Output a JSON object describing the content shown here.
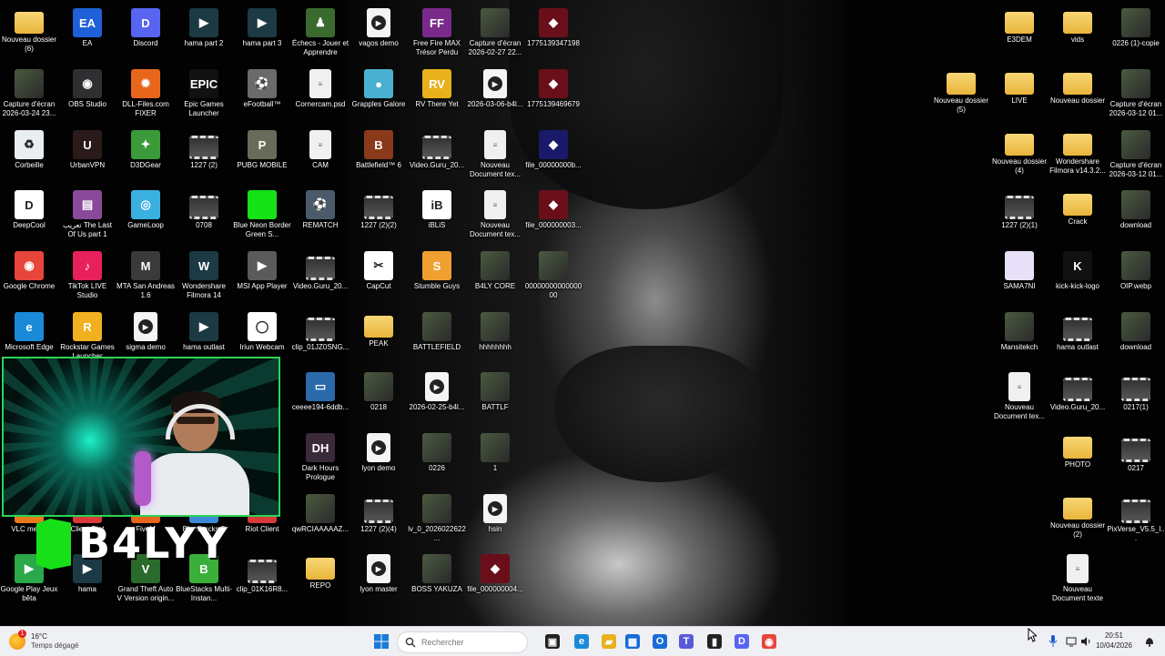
{
  "desktop": {
    "icons": [
      {
        "label": "Nouveau dossier (6)",
        "kind": "folder",
        "glyph": ""
      },
      {
        "label": "EA",
        "kind": "app",
        "glyph": "EA",
        "color": "#1f5fd8"
      },
      {
        "label": "Discord",
        "kind": "app",
        "glyph": "D",
        "color": "#5865f2"
      },
      {
        "label": "hama part 2",
        "kind": "app",
        "glyph": "▶",
        "color": "#1b3a44"
      },
      {
        "label": "hama part 3",
        "kind": "app",
        "glyph": "▶",
        "color": "#1b3a44"
      },
      {
        "label": "Échecs - Jouer et Apprendre",
        "kind": "app",
        "glyph": "♟",
        "color": "#3b6a2e"
      },
      {
        "label": "vagos demo",
        "kind": "video",
        "glyph": "▶"
      },
      {
        "label": "Free Fire MAX Trésor Perdu",
        "kind": "app",
        "glyph": "FF",
        "color": "#7a2a8a"
      },
      {
        "label": "Capture d'écran 2026-02-27 22...",
        "kind": "thumb",
        "glyph": ""
      },
      {
        "label": "1775139347198",
        "kind": "app",
        "glyph": "◆",
        "color": "#6a0f1a"
      },
      {
        "label": "Capture d'écran 2026-03-24 23...",
        "kind": "thumb",
        "glyph": ""
      },
      {
        "label": "OBS Studio",
        "kind": "app",
        "glyph": "◉",
        "color": "#302e31"
      },
      {
        "label": "DLL-Files.com FIXER",
        "kind": "app",
        "glyph": "✹",
        "color": "#e8661c"
      },
      {
        "label": "Epic Games Launcher",
        "kind": "app",
        "glyph": "EPIC",
        "color": "#111"
      },
      {
        "label": "eFootball™",
        "kind": "app",
        "glyph": "⚽",
        "color": "#6a6a6a"
      },
      {
        "label": "Cornercam.psd",
        "kind": "file",
        "glyph": ""
      },
      {
        "label": "Grapples Galore",
        "kind": "app",
        "glyph": "●",
        "color": "#4ab0d0"
      },
      {
        "label": "RV There Yet",
        "kind": "app",
        "glyph": "RV",
        "color": "#e8b11c"
      },
      {
        "label": "2026-03-06-b4l...",
        "kind": "video",
        "glyph": "▶"
      },
      {
        "label": "1775139469679",
        "kind": "app",
        "glyph": "◆",
        "color": "#6a0f1a"
      },
      {
        "label": "Corbeille",
        "kind": "app",
        "glyph": "♻",
        "color": "#e9eef2"
      },
      {
        "label": "UrbanVPN",
        "kind": "app",
        "glyph": "U",
        "color": "#2a1a1a"
      },
      {
        "label": "D3DGear",
        "kind": "app",
        "glyph": "✦",
        "color": "#3a9a3a"
      },
      {
        "label": "1227 (2)",
        "kind": "film",
        "glyph": ""
      },
      {
        "label": "PUBG MOBILE",
        "kind": "app",
        "glyph": "P",
        "color": "#6a6a5a"
      },
      {
        "label": "CAM",
        "kind": "file",
        "glyph": ""
      },
      {
        "label": "Battlefield™ 6",
        "kind": "app",
        "glyph": "B",
        "color": "#8a3a1a"
      },
      {
        "label": "Video.Guru_20...",
        "kind": "film",
        "glyph": ""
      },
      {
        "label": "Nouveau Document tex...",
        "kind": "file",
        "glyph": ""
      },
      {
        "label": "file_00000000b...",
        "kind": "app",
        "glyph": "◆",
        "color": "#1a1a6a"
      },
      {
        "label": "DeepCool",
        "kind": "app",
        "glyph": "D",
        "color": "#fff"
      },
      {
        "label": "تعريب The Last Of Us part 1",
        "kind": "app",
        "glyph": "▤",
        "color": "#8a4a9a"
      },
      {
        "label": "GameLoop",
        "kind": "app",
        "glyph": "◎",
        "color": "#3ab0e0"
      },
      {
        "label": "0708",
        "kind": "film",
        "glyph": ""
      },
      {
        "label": "Blue Neon Border Green S...",
        "kind": "app",
        "glyph": "",
        "color": "#16e016"
      },
      {
        "label": "REMATCH",
        "kind": "app",
        "glyph": "⚽",
        "color": "#4a5a6a"
      },
      {
        "label": "1227 (2)(2)",
        "kind": "film",
        "glyph": ""
      },
      {
        "label": "iBLiS",
        "kind": "app",
        "glyph": "iB",
        "color": "#fff"
      },
      {
        "label": "Nouveau Document tex...",
        "kind": "file",
        "glyph": ""
      },
      {
        "label": "file_000000003...",
        "kind": "app",
        "glyph": "◆",
        "color": "#6a0f1a"
      },
      {
        "label": "Google Chrome",
        "kind": "app",
        "glyph": "◉",
        "color": "#e8453c"
      },
      {
        "label": "TikTok LIVE Studio",
        "kind": "app",
        "glyph": "♪",
        "color": "#e8205c"
      },
      {
        "label": "MTA San Andreas 1.6",
        "kind": "app",
        "glyph": "M",
        "color": "#3a3a3a"
      },
      {
        "label": "Wondershare Filmora 14",
        "kind": "app",
        "glyph": "W",
        "color": "#1b3a44"
      },
      {
        "label": "MSI App Player",
        "kind": "app",
        "glyph": "▶",
        "color": "#5a5a5a"
      },
      {
        "label": "Video.Guru_20...",
        "kind": "film",
        "glyph": ""
      },
      {
        "label": "CapCut",
        "kind": "app",
        "glyph": "✂",
        "color": "#fff"
      },
      {
        "label": "Stumble Guys",
        "kind": "app",
        "glyph": "S",
        "color": "#f0a030"
      },
      {
        "label": "B4LY CORE",
        "kind": "thumb",
        "glyph": ""
      },
      {
        "label": "0000000000000000",
        "kind": "thumb",
        "glyph": ""
      },
      {
        "label": "Microsoft Edge",
        "kind": "app",
        "glyph": "e",
        "color": "#1a8ad8"
      },
      {
        "label": "Rockstar Games Launcher",
        "kind": "app",
        "glyph": "R",
        "color": "#f0b020"
      },
      {
        "label": "sigma demo",
        "kind": "video",
        "glyph": "▶"
      },
      {
        "label": "hama outlast",
        "kind": "app",
        "glyph": "▶",
        "color": "#1b3a44"
      },
      {
        "label": "Iriun Webcam",
        "kind": "app",
        "glyph": "◯",
        "color": "#fff"
      },
      {
        "label": "clip_01JZ0SNG...",
        "kind": "film",
        "glyph": ""
      },
      {
        "label": "PEAK",
        "kind": "folder",
        "glyph": ""
      },
      {
        "label": "BATTLEFIELD",
        "kind": "thumb",
        "glyph": ""
      },
      {
        "label": "hhhhhhhh",
        "kind": "thumb",
        "glyph": ""
      },
      {
        "label": "ceeee194-6ddb...",
        "kind": "app",
        "glyph": "▭",
        "color": "#2a6aaa"
      },
      {
        "label": "0218",
        "kind": "thumb",
        "glyph": ""
      },
      {
        "label": "2026-02-25-b4l...",
        "kind": "video",
        "glyph": "▶"
      },
      {
        "label": "BATTLF",
        "kind": "thumb",
        "glyph": ""
      },
      {
        "label": "Dark Hours Prologue",
        "kind": "app",
        "glyph": "DH",
        "color": "#3a2a3a"
      },
      {
        "label": "lyon demo",
        "kind": "video",
        "glyph": "▶"
      },
      {
        "label": "0226",
        "kind": "thumb",
        "glyph": ""
      },
      {
        "label": "1",
        "kind": "thumb",
        "glyph": ""
      },
      {
        "label": "VLC media",
        "kind": "app",
        "glyph": "▲",
        "color": "#e87a1c"
      },
      {
        "label": "Client Riot",
        "kind": "app",
        "glyph": "R",
        "color": "#d83a3a"
      },
      {
        "label": "FiveM",
        "kind": "app",
        "glyph": "F",
        "color": "#e8661c"
      },
      {
        "label": "BlueStacks 5",
        "kind": "app",
        "glyph": "B",
        "color": "#3a8ad8"
      },
      {
        "label": "Riot Client",
        "kind": "app",
        "glyph": "R",
        "color": "#d83a3a"
      },
      {
        "label": "qwRCIAAAAAZ...",
        "kind": "thumb",
        "glyph": ""
      },
      {
        "label": "1227 (2)(4)",
        "kind": "film",
        "glyph": ""
      },
      {
        "label": "lv_0_2026022622...",
        "kind": "thumb",
        "glyph": ""
      },
      {
        "label": "hsin",
        "kind": "video",
        "glyph": "▶"
      },
      {
        "label": "Google Play Jeux bêta",
        "kind": "app",
        "glyph": "▶",
        "color": "#2aa84a"
      },
      {
        "label": "hama",
        "kind": "app",
        "glyph": "▶",
        "color": "#1b3a44"
      },
      {
        "label": "Grand Theft Auto V Version origin...",
        "kind": "app",
        "glyph": "V",
        "color": "#2a6a2a"
      },
      {
        "label": "BlueStacks Multi-Instan...",
        "kind": "app",
        "glyph": "B",
        "color": "#3ab03a"
      },
      {
        "label": "clip_01K16R8...",
        "kind": "film",
        "glyph": ""
      },
      {
        "label": "REPO",
        "kind": "folder",
        "glyph": ""
      },
      {
        "label": "lyon master",
        "kind": "video",
        "glyph": "▶"
      },
      {
        "label": "BOSS YAKUZA",
        "kind": "thumb",
        "glyph": ""
      },
      {
        "label": "file_000000004...",
        "kind": "app",
        "glyph": "◆",
        "color": "#6a0f1a"
      },
      {
        "label": "Nouveau dossier (3)",
        "kind": "folder",
        "glyph": ""
      },
      {
        "label": "E3DEM",
        "kind": "folder",
        "glyph": ""
      },
      {
        "label": "vids",
        "kind": "folder",
        "glyph": ""
      },
      {
        "label": "0226 (1)-copie",
        "kind": "thumb",
        "glyph": ""
      },
      {
        "label": "Nouveau dossier (5)",
        "kind": "folder",
        "glyph": ""
      },
      {
        "label": "LIVE",
        "kind": "folder",
        "glyph": ""
      },
      {
        "label": "Nouveau dossier",
        "kind": "folder",
        "glyph": ""
      },
      {
        "label": "Capture d'écran 2026-03-12 01...",
        "kind": "thumb",
        "glyph": ""
      },
      {
        "label": "Nouveau dossier (4)",
        "kind": "folder",
        "glyph": ""
      },
      {
        "label": "Wondershare Filmora v14.3.2...",
        "kind": "folder",
        "glyph": ""
      },
      {
        "label": "Capture d'écran 2026-03-12 01...",
        "kind": "thumb",
        "glyph": ""
      },
      {
        "label": "1227 (2)(1)",
        "kind": "film",
        "glyph": ""
      },
      {
        "label": "Crack",
        "kind": "folder",
        "glyph": ""
      },
      {
        "label": "download",
        "kind": "thumb",
        "glyph": ""
      },
      {
        "label": "SAMA7NI",
        "kind": "app",
        "glyph": "",
        "color": "#e8e0f8"
      },
      {
        "label": "kick-kick-logo",
        "kind": "app",
        "glyph": "K",
        "color": "#111"
      },
      {
        "label": "OIP.webp",
        "kind": "thumb",
        "glyph": ""
      },
      {
        "label": "Mansitekch",
        "kind": "thumb",
        "glyph": ""
      },
      {
        "label": "hama outlast",
        "kind": "film",
        "glyph": ""
      },
      {
        "label": "download",
        "kind": "thumb",
        "glyph": ""
      },
      {
        "label": "Nouveau Document tex...",
        "kind": "file",
        "glyph": ""
      },
      {
        "label": "Video.Guru_20...",
        "kind": "film",
        "glyph": ""
      },
      {
        "label": "0217(1)",
        "kind": "film",
        "glyph": ""
      },
      {
        "label": "PHOTO",
        "kind": "folder",
        "glyph": ""
      },
      {
        "label": "0217",
        "kind": "film",
        "glyph": ""
      },
      {
        "label": "Nouveau dossier (2)",
        "kind": "folder",
        "glyph": ""
      },
      {
        "label": "PixVerse_V5.5_l...",
        "kind": "film",
        "glyph": ""
      },
      {
        "label": "Nouveau Document texte",
        "kind": "file",
        "glyph": ""
      }
    ]
  },
  "overlay": {
    "logo_text": "B4LYY"
  },
  "taskbar": {
    "weather": {
      "temp": "16°C",
      "condition": "Temps dégagé",
      "alert_count": "1"
    },
    "search_placeholder": "Rechercher",
    "apps": [
      {
        "name": "windows-start",
        "glyph": "⊞",
        "color": "#1a7ad8"
      },
      {
        "name": "task-view",
        "glyph": "▣",
        "color": "#222"
      },
      {
        "name": "edge",
        "glyph": "e",
        "color": "#1a8ad8"
      },
      {
        "name": "file-explorer",
        "glyph": "▰",
        "color": "#e8b11c"
      },
      {
        "name": "microsoft-store",
        "glyph": "▦",
        "color": "#1a6ad8"
      },
      {
        "name": "outlook",
        "glyph": "O",
        "color": "#1a6ad8"
      },
      {
        "name": "teams",
        "glyph": "T",
        "color": "#5a5ad8"
      },
      {
        "name": "terminal",
        "glyph": "▮",
        "color": "#222"
      },
      {
        "name": "discord",
        "glyph": "D",
        "color": "#5865f2"
      },
      {
        "name": "chrome",
        "glyph": "◉",
        "color": "#e8453c"
      },
      {
        "name": "obs",
        "glyph": "◉",
        "color": "#302e31"
      }
    ],
    "clock": {
      "time": "20:51",
      "date": "10/04/2026"
    }
  }
}
